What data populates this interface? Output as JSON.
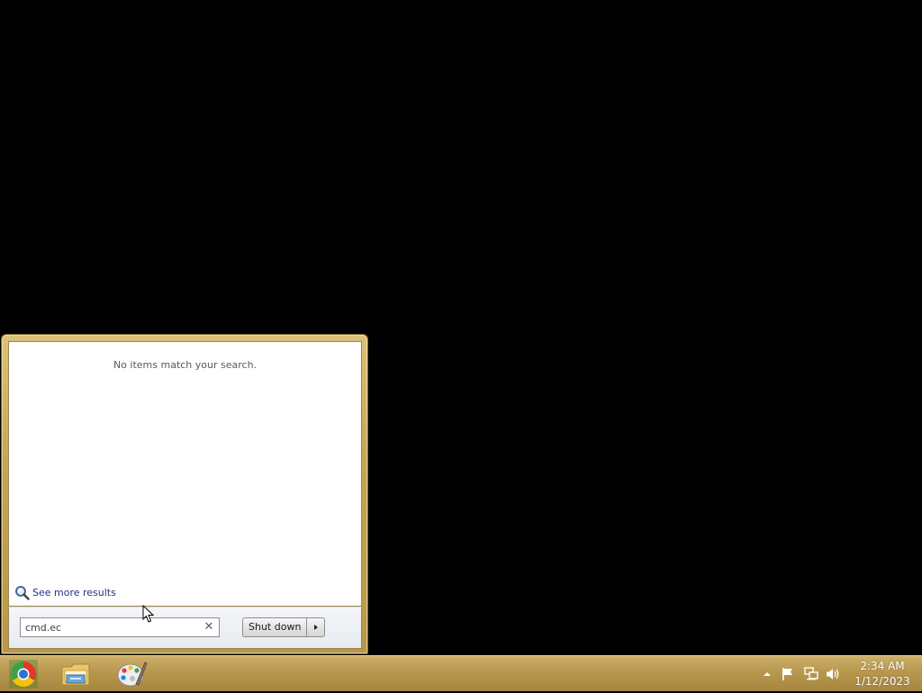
{
  "start_menu": {
    "no_results_text": "No items match your search.",
    "see_more_label": "See more results",
    "search": {
      "value": "cmd.ec",
      "clear_glyph": "✕"
    },
    "shutdown_label": "Shut down"
  },
  "taskbar": {
    "pinned": [
      {
        "name": "chrome-icon"
      },
      {
        "name": "windows-explorer-icon"
      },
      {
        "name": "paint-icon"
      }
    ],
    "tray": [
      "show-hidden-icons-icon",
      "action-center-flag-icon",
      "network-icon",
      "volume-icon"
    ],
    "clock": {
      "time": "2:34 AM",
      "date": "1/12/2023"
    }
  },
  "colors": {
    "frame_gold": "#c5a654",
    "taskbar_gold": "#b8974e",
    "desktop": "#000000"
  }
}
